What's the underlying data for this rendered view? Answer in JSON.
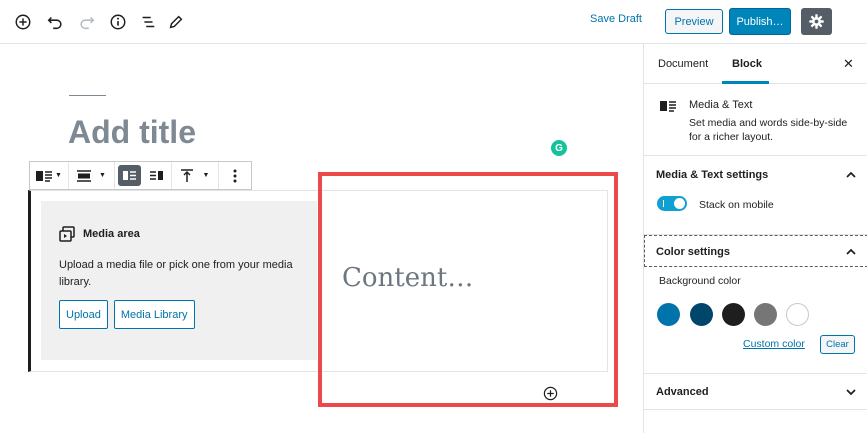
{
  "toolbar": {
    "icons": [
      "add-block-icon",
      "undo-icon",
      "redo-icon",
      "info-icon",
      "block-navigation-icon",
      "edit-icon"
    ],
    "save_draft": "Save Draft",
    "preview": "Preview",
    "publish": "Publish…",
    "settings_icon": "gear-icon"
  },
  "editor": {
    "title_placeholder": "Add title",
    "media": {
      "label": "Media area",
      "description": "Upload a media file or pick one from your media library.",
      "upload_button": "Upload",
      "library_button": "Media Library"
    },
    "content_placeholder": "Content…",
    "highlight_color": "#ec4a4a"
  },
  "sidebar": {
    "tabs": [
      {
        "label": "Document",
        "active": false
      },
      {
        "label": "Block",
        "active": true
      }
    ],
    "close_icon": "close-icon",
    "block_card": {
      "name": "Media & Text",
      "description": "Set media and words side-by-side for a richer layout."
    },
    "panels": {
      "media_text_settings": {
        "title": "Media & Text settings",
        "expanded": true,
        "toggle_label": "Stack on mobile",
        "toggle_on": true
      },
      "color_settings": {
        "title": "Color settings",
        "expanded": true,
        "background_label": "Background color",
        "swatches": [
          "#0073aa",
          "#00466b",
          "#1e1e1e",
          "#767676",
          "#ffffff"
        ],
        "custom_color": "Custom color",
        "clear": "Clear"
      },
      "advanced": {
        "title": "Advanced",
        "expanded": false
      }
    }
  }
}
